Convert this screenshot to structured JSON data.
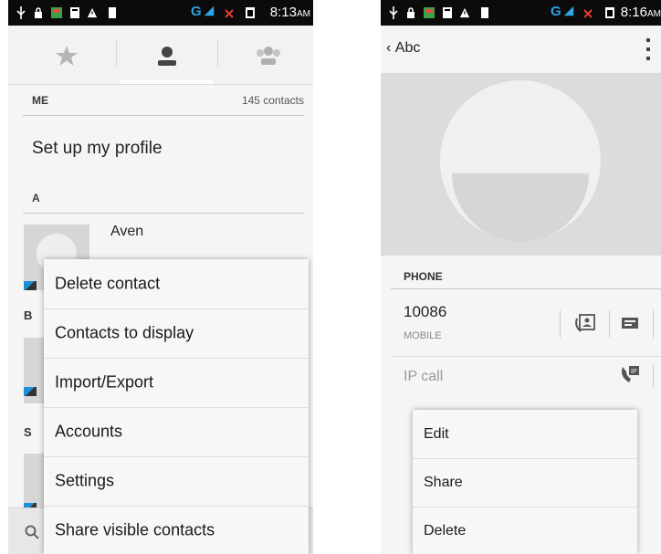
{
  "left_screen": {
    "status_bar": {
      "time": "8:13",
      "ampm": "AM",
      "network": "G"
    },
    "tabs": [
      {
        "name": "favorites",
        "icon": "star-icon"
      },
      {
        "name": "contacts",
        "icon": "person-icon",
        "selected": true
      },
      {
        "name": "groups",
        "icon": "group-icon"
      }
    ],
    "me_section": {
      "label": "ME",
      "count": "145 contacts"
    },
    "profile_label": "Set up my profile",
    "section_a": "A",
    "contact_name": "Aven",
    "side_letters": [
      "B",
      "S"
    ],
    "menu": {
      "items": [
        {
          "label": "Delete contact"
        },
        {
          "label": "Contacts to display"
        },
        {
          "label": "Import/Export"
        },
        {
          "label": "Accounts"
        },
        {
          "label": "Settings"
        },
        {
          "label": "Share visible contacts"
        }
      ]
    }
  },
  "right_screen": {
    "status_bar": {
      "time": "8:16",
      "ampm": "AM",
      "network": "G"
    },
    "title": "Abc",
    "phone_section": "PHONE",
    "number": "10086",
    "number_type": "MOBILE",
    "ip_call": "IP call",
    "menu": {
      "items": [
        {
          "label": "Edit"
        },
        {
          "label": "Share"
        },
        {
          "label": "Delete"
        }
      ]
    }
  },
  "colors": {
    "accent": "#1e8fd4",
    "network": "#2aa6e8",
    "status_bar": "#0b0b0b"
  }
}
